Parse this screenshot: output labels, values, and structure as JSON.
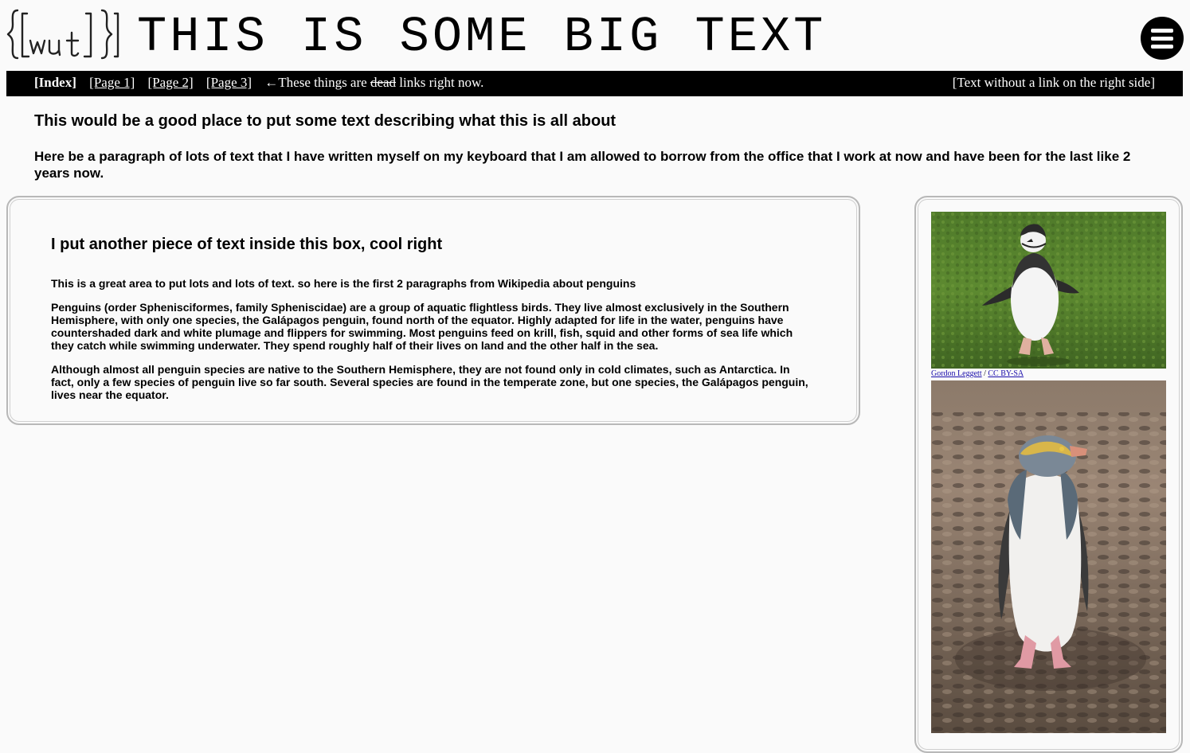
{
  "header": {
    "logo_text": "{[wut}]",
    "title": "THIS IS SOME BIG TEXT",
    "menu_icon": "hamburger-icon"
  },
  "nav": {
    "items": [
      {
        "label": "[Index]",
        "current": true
      },
      {
        "label": "[Page 1]",
        "current": false
      },
      {
        "label": "[Page 2]",
        "current": false
      },
      {
        "label": "[Page 3]",
        "current": false
      }
    ],
    "note_prefix": "←These things are ",
    "note_strike": "dead",
    "note_suffix": " links right now.",
    "right_text": "[Text without a link on the right side]"
  },
  "intro": {
    "heading": "This would be a good place to put some text describing what this is all about",
    "paragraph": "Here be a paragraph of lots of text that I have written myself on my keyboard that I am allowed to borrow from the office that I work at now and have been for the last like 2 years now."
  },
  "box": {
    "heading": "I put another piece of text inside this box, cool right",
    "paragraphs": [
      "This is a great area to put lots and lots of text. so here is the first 2 paragraphs from Wikipedia about penguins",
      "Penguins (order Sphenisciformes, family Spheniscidae) are a group of aquatic flightless birds. They live almost exclusively in the Southern Hemisphere, with only one species, the Galápagos penguin, found north of the equator. Highly adapted for life in the water, penguins have countershaded dark and white plumage and flippers for swimming. Most penguins feed on krill, fish, squid and other forms of sea life which they catch while swimming underwater. They spend roughly half of their lives on land and the other half in the sea.",
      "Although almost all penguin species are native to the Southern Hemisphere, they are not found only in cold climates, such as Antarctica. In fact, only a few species of penguin live so far south. Several species are found in the temperate zone, but one species, the Galápagos penguin, lives near the equator."
    ]
  },
  "sidebar": {
    "credit_author": "Gordon Leggett",
    "credit_separator": " / ",
    "credit_license": "CC BY-SA"
  }
}
